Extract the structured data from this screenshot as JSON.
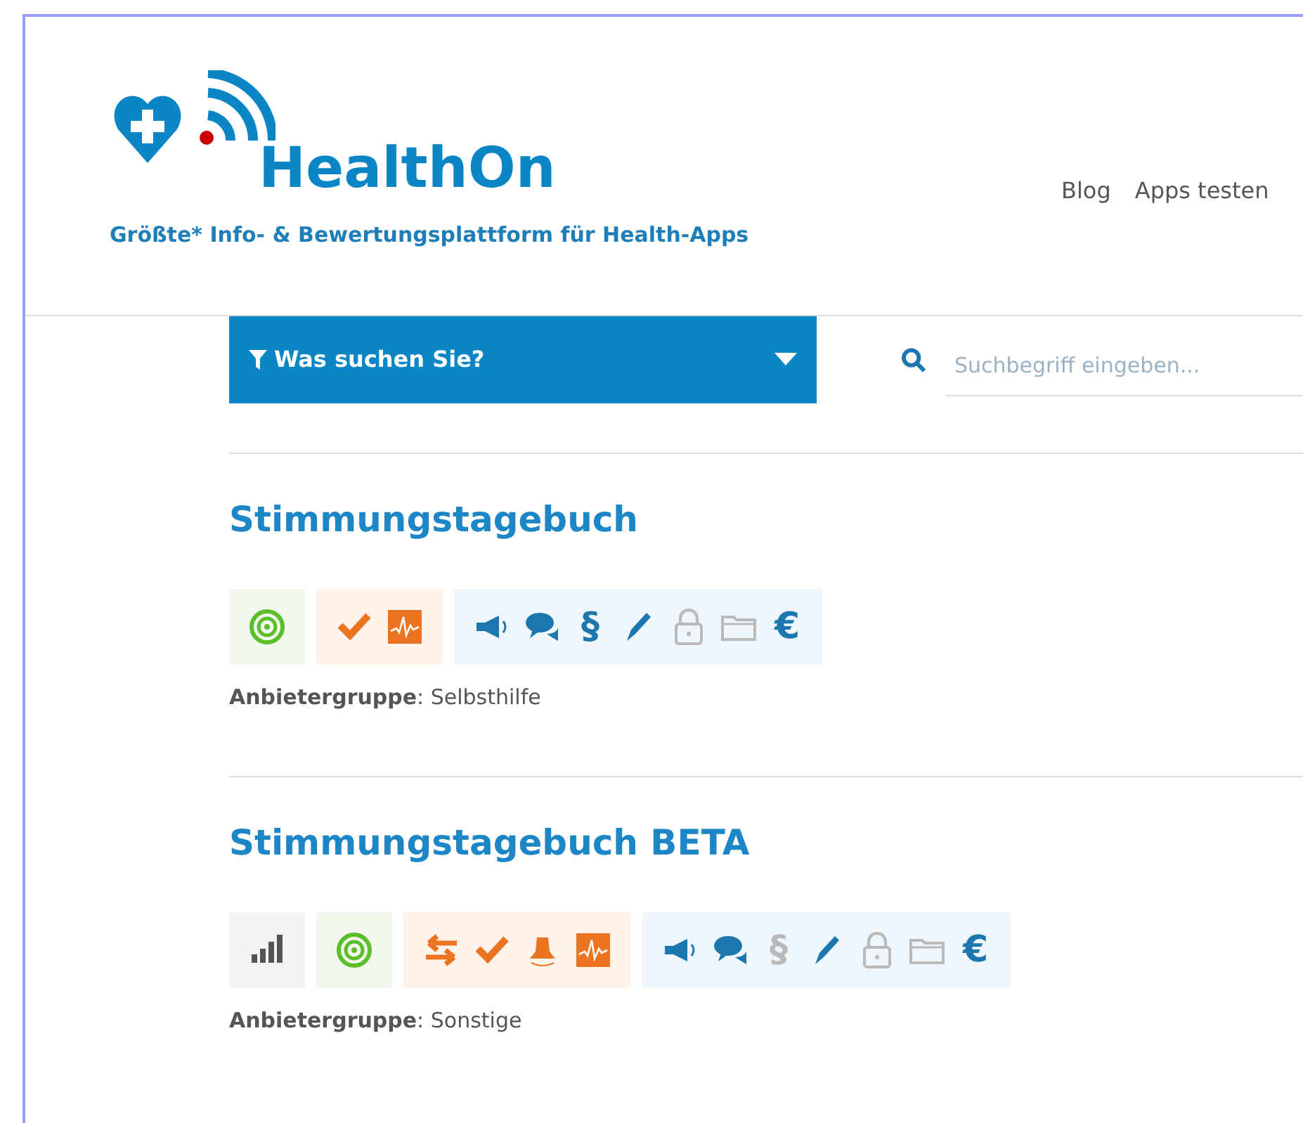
{
  "header": {
    "logo_text": "HealthOn",
    "tagline": "Größte* Info- & Bewertungsplattform für Health-Apps",
    "nav": [
      "Blog",
      "Apps testen"
    ]
  },
  "filter": {
    "label": "Was suchen Sie?",
    "expanded": false
  },
  "search": {
    "placeholder": "Suchbegriff eingeben..."
  },
  "apps": [
    {
      "title": "Stimmungstagebuch",
      "groups": [
        {
          "kind": "green",
          "icons": [
            {
              "kind": "spiral",
              "active": true
            }
          ]
        },
        {
          "kind": "orange",
          "icons": [
            {
              "kind": "check",
              "active": true
            },
            {
              "kind": "chart",
              "active": true
            }
          ]
        },
        {
          "kind": "blue",
          "icons": [
            {
              "kind": "megaphone",
              "active": true
            },
            {
              "kind": "chat",
              "active": true
            },
            {
              "kind": "glyph",
              "glyph": "§",
              "active": true
            },
            {
              "kind": "pencil",
              "active": true
            },
            {
              "kind": "lock",
              "active": false
            },
            {
              "kind": "folder",
              "active": false
            },
            {
              "kind": "glyph",
              "glyph": "€",
              "active": true
            }
          ]
        }
      ],
      "provider_label": "Anbietergruppe",
      "provider": ": Selbsthilfe"
    },
    {
      "title": "Stimmungstagebuch BETA",
      "groups": [
        {
          "kind": "grey",
          "icons": [
            {
              "kind": "signal",
              "active": true
            }
          ]
        },
        {
          "kind": "green",
          "icons": [
            {
              "kind": "spiral",
              "active": true
            }
          ]
        },
        {
          "kind": "orange",
          "icons": [
            {
              "kind": "arrows",
              "active": true
            },
            {
              "kind": "check",
              "active": true
            },
            {
              "kind": "bell",
              "active": true
            },
            {
              "kind": "chart",
              "active": true
            }
          ]
        },
        {
          "kind": "blue",
          "icons": [
            {
              "kind": "megaphone",
              "active": true
            },
            {
              "kind": "chat",
              "active": true
            },
            {
              "kind": "glyph",
              "glyph": "§",
              "active": false
            },
            {
              "kind": "pencil",
              "active": true
            },
            {
              "kind": "lock",
              "active": false
            },
            {
              "kind": "folder",
              "active": false
            },
            {
              "kind": "glyph",
              "glyph": "€",
              "active": true
            }
          ]
        }
      ],
      "provider_label": "Anbietergruppe",
      "provider": ": Sonstige"
    }
  ]
}
